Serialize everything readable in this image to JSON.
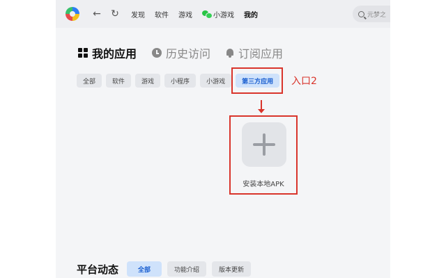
{
  "topbar": {
    "links": [
      "发现",
      "软件",
      "游戏"
    ],
    "mini_games": "小游戏",
    "mine": "我的",
    "search_placeholder": "元梦之"
  },
  "main_tabs": [
    {
      "label": "我的应用",
      "icon": "grid-icon",
      "active": true
    },
    {
      "label": "历史访问",
      "icon": "clock-icon",
      "active": false
    },
    {
      "label": "订阅应用",
      "icon": "bell-icon",
      "active": false
    }
  ],
  "categories": [
    "全部",
    "软件",
    "游戏",
    "小程序",
    "小游戏",
    "第三方应用"
  ],
  "selected_category": "第三方应用",
  "annotation": {
    "label": "入口2",
    "color": "#d9342b"
  },
  "install": {
    "label": "安装本地APK",
    "icon": "plus-icon"
  },
  "news": {
    "title": "平台动态",
    "tabs": [
      "全部",
      "功能介绍",
      "版本更新"
    ],
    "selected": "全部"
  },
  "colors": {
    "accent": "#1a5fd0",
    "accent_bg": "#cfe2fb",
    "annotation": "#d9342b"
  }
}
